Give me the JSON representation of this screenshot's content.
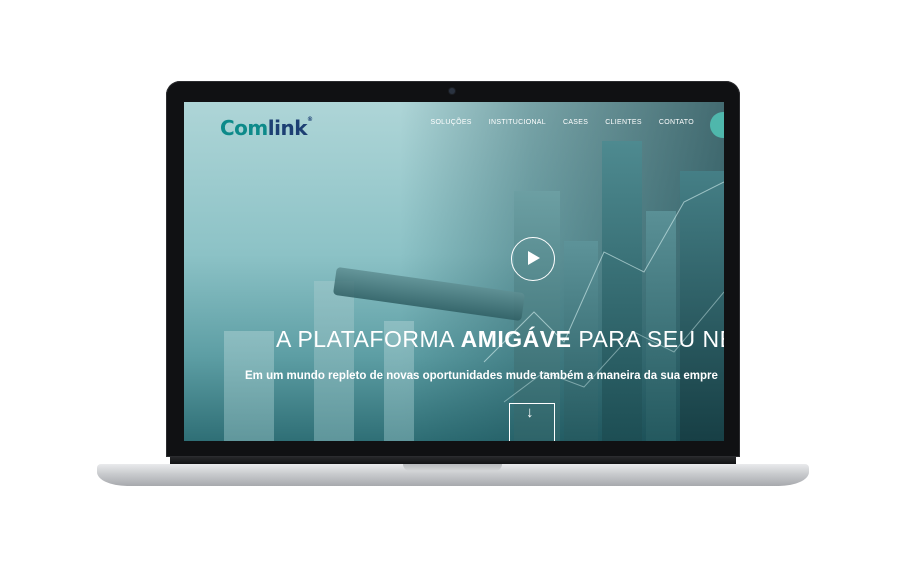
{
  "brand": {
    "name_part1": "Com",
    "name_part2": "link",
    "reg": "®"
  },
  "nav": {
    "items": [
      "SOLUÇÕES",
      "INSTITUCIONAL",
      "CASES",
      "CLIENTES",
      "CONTATO"
    ]
  },
  "hero": {
    "headline_pre": "A PLATAFORMA ",
    "headline_bold": "AMIGÁVE",
    "headline_post": " PARA SEU NEG",
    "subtitle": "Em um mundo repleto de novas oportunidades mude também a maneira da sua empre",
    "scroll_arrow": "↓"
  },
  "colors": {
    "brand_teal": "#0d8a8a",
    "brand_navy": "#1d3f73",
    "nav_accent": "#4fb7ac"
  },
  "icons": {
    "play": "play-icon",
    "scroll": "arrow-down-icon"
  }
}
